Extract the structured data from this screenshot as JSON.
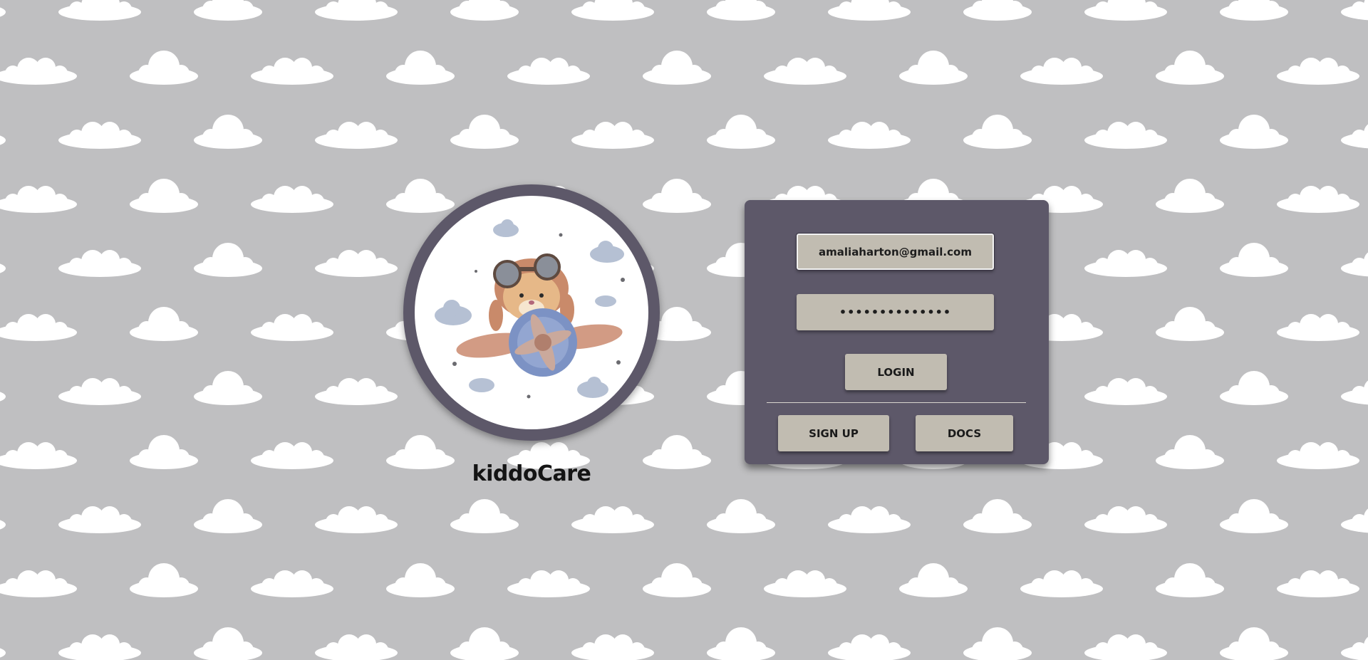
{
  "brand": {
    "name": "kiddoCare"
  },
  "login": {
    "email_value": "amaliaharton@gmail.com",
    "password_mask": "••••••••••••••",
    "login_label": "LOGIN",
    "signup_label": "SIGN UP",
    "docs_label": "DOCS"
  },
  "colors": {
    "background": "#bfbfc1",
    "panel": "#5d5869",
    "button": "#c1bcb1",
    "cloud": "#ffffff"
  },
  "icons": {
    "logo": "aviator-hamster-airplane-illustration"
  }
}
